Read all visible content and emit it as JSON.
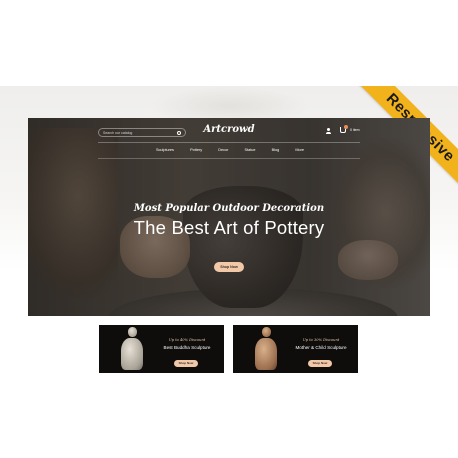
{
  "ribbon": {
    "label": "Responsive",
    "color": "#f2b21b"
  },
  "header": {
    "logo": "Artcrowd",
    "search_placeholder": "Search our catalog",
    "cart_text": "0 item"
  },
  "nav": {
    "items": [
      {
        "label": "Sculptures"
      },
      {
        "label": "Pottery"
      },
      {
        "label": "Decor"
      },
      {
        "label": "Statue"
      },
      {
        "label": "Blog"
      },
      {
        "label": "More"
      }
    ]
  },
  "hero": {
    "subtitle": "Most Popular Outdoor Decoration",
    "title": "The Best Art of Pottery",
    "button": "Shop Now",
    "accent": "#f1c8a8"
  },
  "banners": [
    {
      "small": "Up to 40% Discount",
      "title": "Best Buddha Sculpture",
      "button": "Shop Now"
    },
    {
      "small": "Up to 30% Discount",
      "title": "Mother & Child Sculpture",
      "button": "Shop Now"
    }
  ]
}
